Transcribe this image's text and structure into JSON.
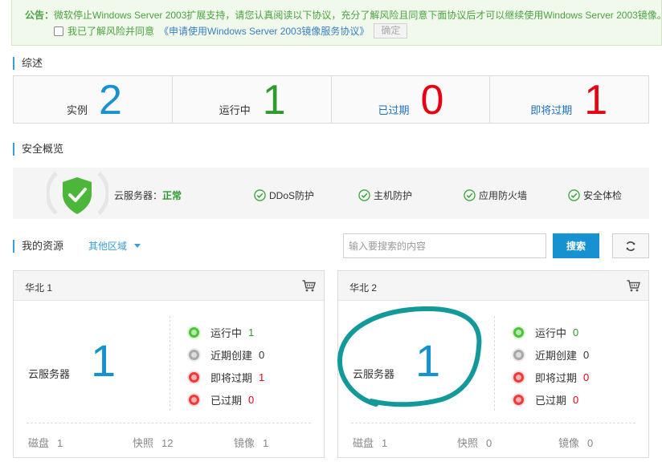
{
  "notice": {
    "prefix": "公告：",
    "text": "微软停止Windows Server 2003扩展支持，请您认真阅读以下协议，充分了解风险且同意下面协议后才可以继续使用Windows Server 2003镜像。",
    "agree_label": "我已了解风险并同意",
    "agreement_link": "《申请使用Windows Server 2003镜像服务协议》",
    "confirm_label": "确定"
  },
  "overview": {
    "title": "综述",
    "cells": [
      {
        "label": "实例",
        "value": "2"
      },
      {
        "label": "运行中",
        "value": "1"
      },
      {
        "label": "已过期",
        "value": "0"
      },
      {
        "label": "即将过期",
        "value": "1"
      }
    ]
  },
  "security": {
    "title": "安全概览",
    "server_label": "云服务器：",
    "server_status": "正常",
    "items": [
      "DDoS防护",
      "主机防护",
      "应用防火墙",
      "安全体检"
    ]
  },
  "resources": {
    "title": "我的资源",
    "region_select": "其他区域",
    "search_placeholder": "输入要搜索的内容",
    "search_label": "搜索"
  },
  "regions": [
    {
      "name": "华北 1",
      "server_label": "云服务器",
      "server_count": "1",
      "statuses": [
        {
          "label": "运行中",
          "value": "1"
        },
        {
          "label": "近期创建",
          "value": "0"
        },
        {
          "label": "即将过期",
          "value": "1"
        },
        {
          "label": "已过期",
          "value": "0"
        }
      ],
      "footer": [
        {
          "label": "磁盘",
          "value": "1"
        },
        {
          "label": "快照",
          "value": "12"
        },
        {
          "label": "镜像",
          "value": "1"
        }
      ]
    },
    {
      "name": "华北 2",
      "server_label": "云服务器",
      "server_count": "1",
      "statuses": [
        {
          "label": "运行中",
          "value": "0"
        },
        {
          "label": "近期创建",
          "value": "0"
        },
        {
          "label": "即将过期",
          "value": "0"
        },
        {
          "label": "已过期",
          "value": "0"
        }
      ],
      "footer": [
        {
          "label": "磁盘",
          "value": "1"
        },
        {
          "label": "快照",
          "value": "0"
        },
        {
          "label": "镜像",
          "value": "0"
        }
      ]
    }
  ],
  "colors": {
    "accent": "#1792d0",
    "ok_green": "#2e9b2e",
    "danger_red": "#e60012",
    "annotation": "#14999a"
  },
  "icons": [
    "shield-check-icon",
    "check-circle-icon",
    "refresh-icon",
    "cart-icon",
    "caret-down-icon",
    "status-dot-icon"
  ]
}
